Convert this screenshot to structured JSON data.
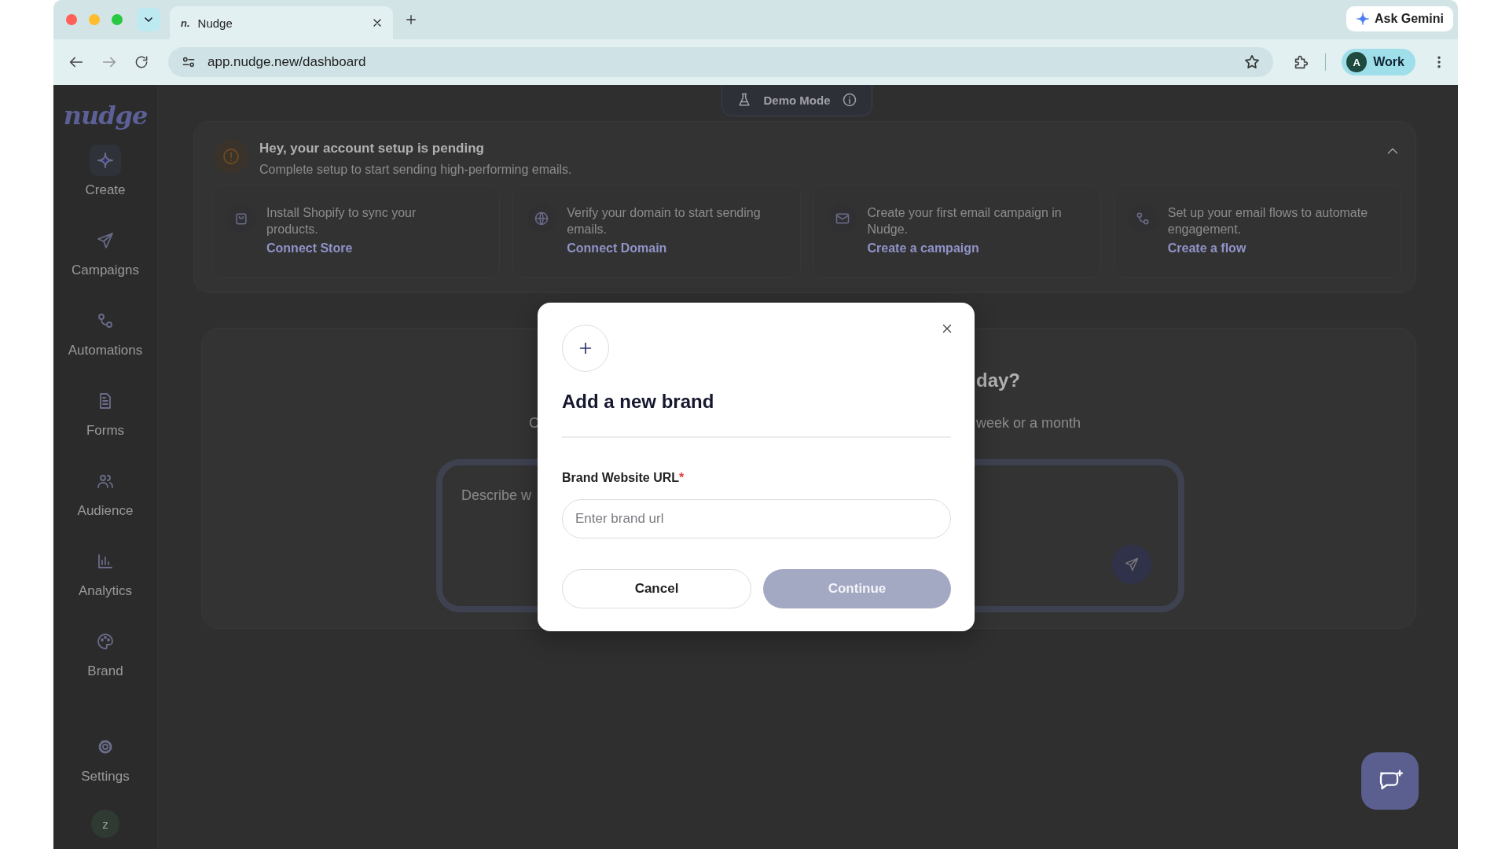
{
  "browser": {
    "tabs": [
      {
        "favicon": "n.",
        "title": "Nudge",
        "selected": true
      }
    ],
    "ask_button": "Ask Gemini",
    "url": "app.nudge.new/dashboard",
    "profile": {
      "initial": "A",
      "label": "Work"
    }
  },
  "sidebar": {
    "logo": "nudge",
    "items": [
      {
        "label": "Create"
      },
      {
        "label": "Campaigns"
      },
      {
        "label": "Automations"
      },
      {
        "label": "Forms"
      },
      {
        "label": "Audience"
      },
      {
        "label": "Analytics"
      },
      {
        "label": "Brand"
      }
    ],
    "settings": "Settings",
    "avatar": "z"
  },
  "demo_mode": "Demo Mode",
  "setup": {
    "title": "Hey, your account setup is pending",
    "subtitle": "Complete setup to start sending high-performing emails.",
    "expanded": true,
    "steps": [
      {
        "text": "Install Shopify to sync your products.",
        "action": "Connect Store"
      },
      {
        "text": "Verify your domain to start sending emails.",
        "action": "Connect Domain"
      },
      {
        "text": "Create your first email campaign in Nudge.",
        "action": "Create a campaign"
      },
      {
        "text": "Set up your email flows to automate engagement.",
        "action": "Create a flow"
      }
    ]
  },
  "hero": {
    "title_right": "day?",
    "subtitle_left": "C",
    "subtitle_right": "week or a month",
    "prompt_hint": "Describe w"
  },
  "modal": {
    "title": "Add a new brand",
    "field": {
      "label": "Brand Website URL",
      "required_mark": "*",
      "placeholder": "Enter brand url"
    },
    "buttons": [
      {
        "label": "Cancel",
        "kind": "secondary",
        "disabled": false
      },
      {
        "label": "Continue",
        "kind": "primary",
        "disabled": true
      }
    ]
  }
}
